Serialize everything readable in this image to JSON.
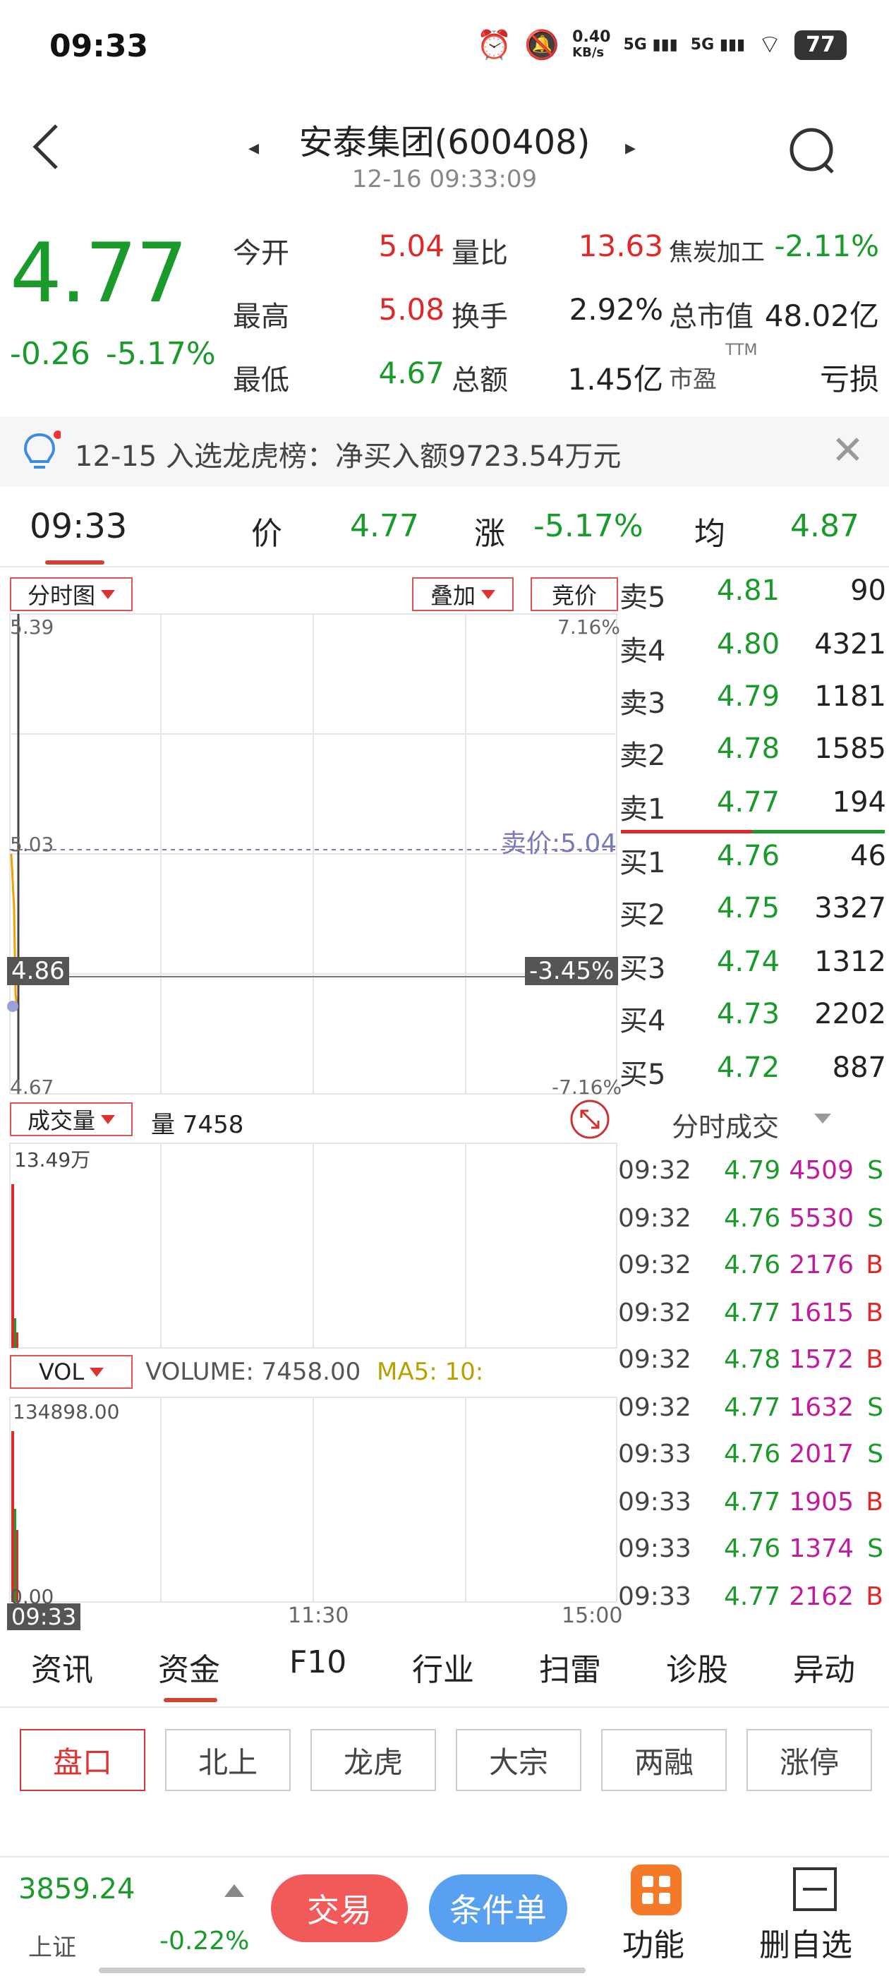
{
  "status": {
    "time": "09:33",
    "net_speed": "0.40",
    "net_unit": "KB/s",
    "sig1": "5G",
    "sig2": "5G",
    "battery": "77"
  },
  "header": {
    "title": "安泰集团(600408)",
    "subtitle": "12-16 09:33:09"
  },
  "quote": {
    "price": "4.77",
    "change": "-0.26",
    "change_pct": "-5.17%",
    "open_label": "今开",
    "open": "5.04",
    "high_label": "最高",
    "high": "5.08",
    "low_label": "最低",
    "low": "4.67",
    "vr_label": "量比",
    "vr": "13.63",
    "turnover_label": "换手",
    "turnover": "2.92%",
    "amount_label": "总额",
    "amount": "1.45亿",
    "sector": "焦炭加工",
    "sector_pct": "-2.11%",
    "mcap_label": "总市值",
    "mcap": "48.02亿",
    "pe_label": "市盈",
    "pe_sup": "TTM",
    "pe": "亏损"
  },
  "notice": {
    "text": "12-15 入选龙虎榜：净买入额9723.54万元"
  },
  "price_line": {
    "time": "09:33",
    "price_label": "价",
    "price": "4.77",
    "chg_label": "涨",
    "chg": "-5.17%",
    "avg_label": "均",
    "avg": "4.87"
  },
  "chart": {
    "chips": {
      "timeline": "分时图",
      "overlay": "叠加",
      "auction": "竞价",
      "volume": "成交量",
      "vol": "VOL"
    },
    "y_top": "5.39",
    "y_top_pct": "7.16%",
    "y_ref": "5.03",
    "ask_line": "卖价:5.04",
    "cur_price": "4.86",
    "cur_pct": "-3.45%",
    "y_bot": "4.67",
    "y_bot_pct": "-7.16%",
    "vol_label": "量 7458",
    "vol_max": "13.49万",
    "ind_label": "VOLUME: 7458.00",
    "ma5_label": "MA5: 10:",
    "ind_max": "134898.00",
    "ind_min": "0.00",
    "x_start": "09:33",
    "x_mid": "11:30",
    "x_end": "15:00"
  },
  "order_book": {
    "asks": [
      {
        "label": "卖5",
        "price": "4.81",
        "vol": "90"
      },
      {
        "label": "卖4",
        "price": "4.80",
        "vol": "4321"
      },
      {
        "label": "卖3",
        "price": "4.79",
        "vol": "1181"
      },
      {
        "label": "卖2",
        "price": "4.78",
        "vol": "1585"
      },
      {
        "label": "卖1",
        "price": "4.77",
        "vol": "194"
      }
    ],
    "bids": [
      {
        "label": "买1",
        "price": "4.76",
        "vol": "46"
      },
      {
        "label": "买2",
        "price": "4.75",
        "vol": "3327"
      },
      {
        "label": "买3",
        "price": "4.74",
        "vol": "1312"
      },
      {
        "label": "买4",
        "price": "4.73",
        "vol": "2202"
      },
      {
        "label": "买5",
        "price": "4.72",
        "vol": "887"
      }
    ]
  },
  "trades": {
    "title": "分时成交",
    "rows": [
      {
        "time": "09:32",
        "price": "4.79",
        "vol": "4509",
        "side": "S"
      },
      {
        "time": "09:32",
        "price": "4.76",
        "vol": "5530",
        "side": "S"
      },
      {
        "time": "09:32",
        "price": "4.76",
        "vol": "2176",
        "side": "B"
      },
      {
        "time": "09:32",
        "price": "4.77",
        "vol": "1615",
        "side": "B"
      },
      {
        "time": "09:32",
        "price": "4.78",
        "vol": "1572",
        "side": "B"
      },
      {
        "time": "09:32",
        "price": "4.77",
        "vol": "1632",
        "side": "S"
      },
      {
        "time": "09:33",
        "price": "4.76",
        "vol": "2017",
        "side": "S"
      },
      {
        "time": "09:33",
        "price": "4.77",
        "vol": "1905",
        "side": "B"
      },
      {
        "time": "09:33",
        "price": "4.76",
        "vol": "1374",
        "side": "S"
      },
      {
        "time": "09:33",
        "price": "4.77",
        "vol": "2162",
        "side": "B"
      }
    ]
  },
  "tabs": [
    "资讯",
    "资金",
    "F10",
    "行业",
    "扫雷",
    "诊股",
    "异动"
  ],
  "sub_tabs": [
    "盘口",
    "北上",
    "龙虎",
    "大宗",
    "两融",
    "涨停"
  ],
  "footer": {
    "index_value": "3859.24",
    "index_name": "上证",
    "index_pct": "-0.22%",
    "trade": "交易",
    "conditional": "条件单",
    "func": "功能",
    "del_fav": "删自选"
  },
  "colors": {
    "up": "#e02828",
    "down": "#1a9a2a",
    "accent": "#e8890c"
  }
}
